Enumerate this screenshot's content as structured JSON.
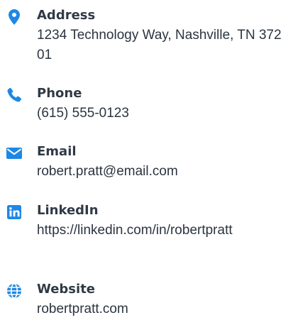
{
  "colors": {
    "icon": "#1e88e5",
    "label": "#303a46",
    "value": "#2b3440"
  },
  "contacts": [
    {
      "icon": "map-pin-icon",
      "label": "Address",
      "value": "1234 Technology Way, Nashville, TN 37201"
    },
    {
      "icon": "phone-icon",
      "label": "Phone",
      "value": "(615) 555-0123"
    },
    {
      "icon": "envelope-icon",
      "label": "Email",
      "value": "robert.pratt@email.com"
    },
    {
      "icon": "linkedin-icon",
      "label": "LinkedIn",
      "value": "https://linkedin.com/in/robertpratt"
    },
    {
      "icon": "globe-icon",
      "label": "Website",
      "value": "robertpratt.com"
    }
  ]
}
